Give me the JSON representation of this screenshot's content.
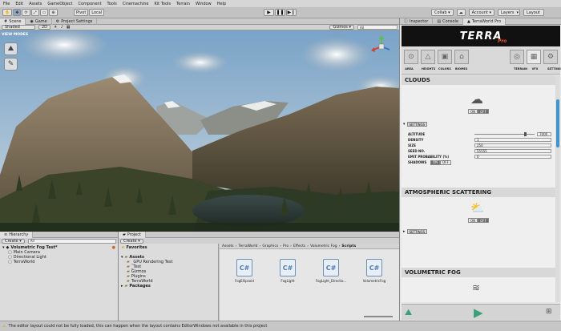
{
  "menu": [
    "File",
    "Edit",
    "Assets",
    "GameObject",
    "Component",
    "Tools",
    "Cinemachine",
    "Kit Tools",
    "Terrain",
    "Window",
    "Help"
  ],
  "toolbar": {
    "pivot": "Pivot",
    "local": "Local",
    "collab": "Collab ▾",
    "account": "Account ▾",
    "layers": "Layers",
    "layout": "Layout"
  },
  "scene_tabs": {
    "scene": "Scene",
    "game": "Game",
    "project_settings": "Project Settings"
  },
  "scene_bar": {
    "shading": "Shaded",
    "mode2d": "2D",
    "gizmos": "Gizmos ▾",
    "search": "All"
  },
  "view_modes": "VIEW MODES",
  "hierarchy": {
    "tab": "Hierarchy",
    "create": "Create ▾",
    "search": "All",
    "scene": "Volumetric Fog Test*",
    "items": [
      "Main Camera",
      "Directional Light",
      "TerraWorld"
    ]
  },
  "project": {
    "tab": "Project",
    "create": "Create ▾",
    "favorites": "Favorites",
    "assets": "Assets",
    "tree": [
      "_GPU Rendering Test",
      "_Test",
      "Gizmos",
      "Plugins",
      "TerraWorld"
    ],
    "packages": "Packages",
    "breadcrumb": [
      "Assets",
      "TerraWorld",
      "Graphics",
      "Pro",
      "Effects",
      "Volumetric Fog",
      "Scripts"
    ],
    "files": [
      "FogEllipsoid",
      "FogLight",
      "FogLight_Directio...",
      "VolumetricFog"
    ],
    "file_icon": "C#"
  },
  "inspector": {
    "tabs": [
      "Inspector",
      "Console",
      "TerraWorld Pro"
    ],
    "logo": "TERRA",
    "logo_sub": "Pro",
    "nav_left": [
      "AREA",
      "HEIGHTS",
      "COLORS",
      "BIOMES"
    ],
    "nav_right": [
      "TERRAIN",
      "VFX",
      "SETTINGS"
    ],
    "clouds": {
      "title": "CLOUDS",
      "on": "ON",
      "off": "OFF",
      "settings": "SETTINGS",
      "fields": [
        {
          "label": "ALTITUDE",
          "value": "7000"
        },
        {
          "label": "DENSITY",
          "value": "1"
        },
        {
          "label": "SIZE",
          "value": "250"
        },
        {
          "label": "SEED NO.",
          "value": "55555"
        },
        {
          "label": "EMIT PROBABILITY (%)",
          "value": "0"
        }
      ],
      "altitude_slider": 0.86,
      "shadows_label": "SHADOWS",
      "shadows_on": "ON",
      "shadows_off": "OFF"
    },
    "atmospheric": {
      "title": "ATMOSPHERIC SCATTERING",
      "on": "ON",
      "off": "OFF",
      "settings": "SETTINGS"
    },
    "fog": {
      "title": "VOLUMETRIC FOG"
    }
  },
  "status": "The editor layout could not be fully loaded, this can happen when the layout contains EditorWindows not available in this project",
  "colors": {
    "accent": "#3f95cc",
    "play": "#39a07a",
    "inspector_bg": "#e8e8e8"
  }
}
